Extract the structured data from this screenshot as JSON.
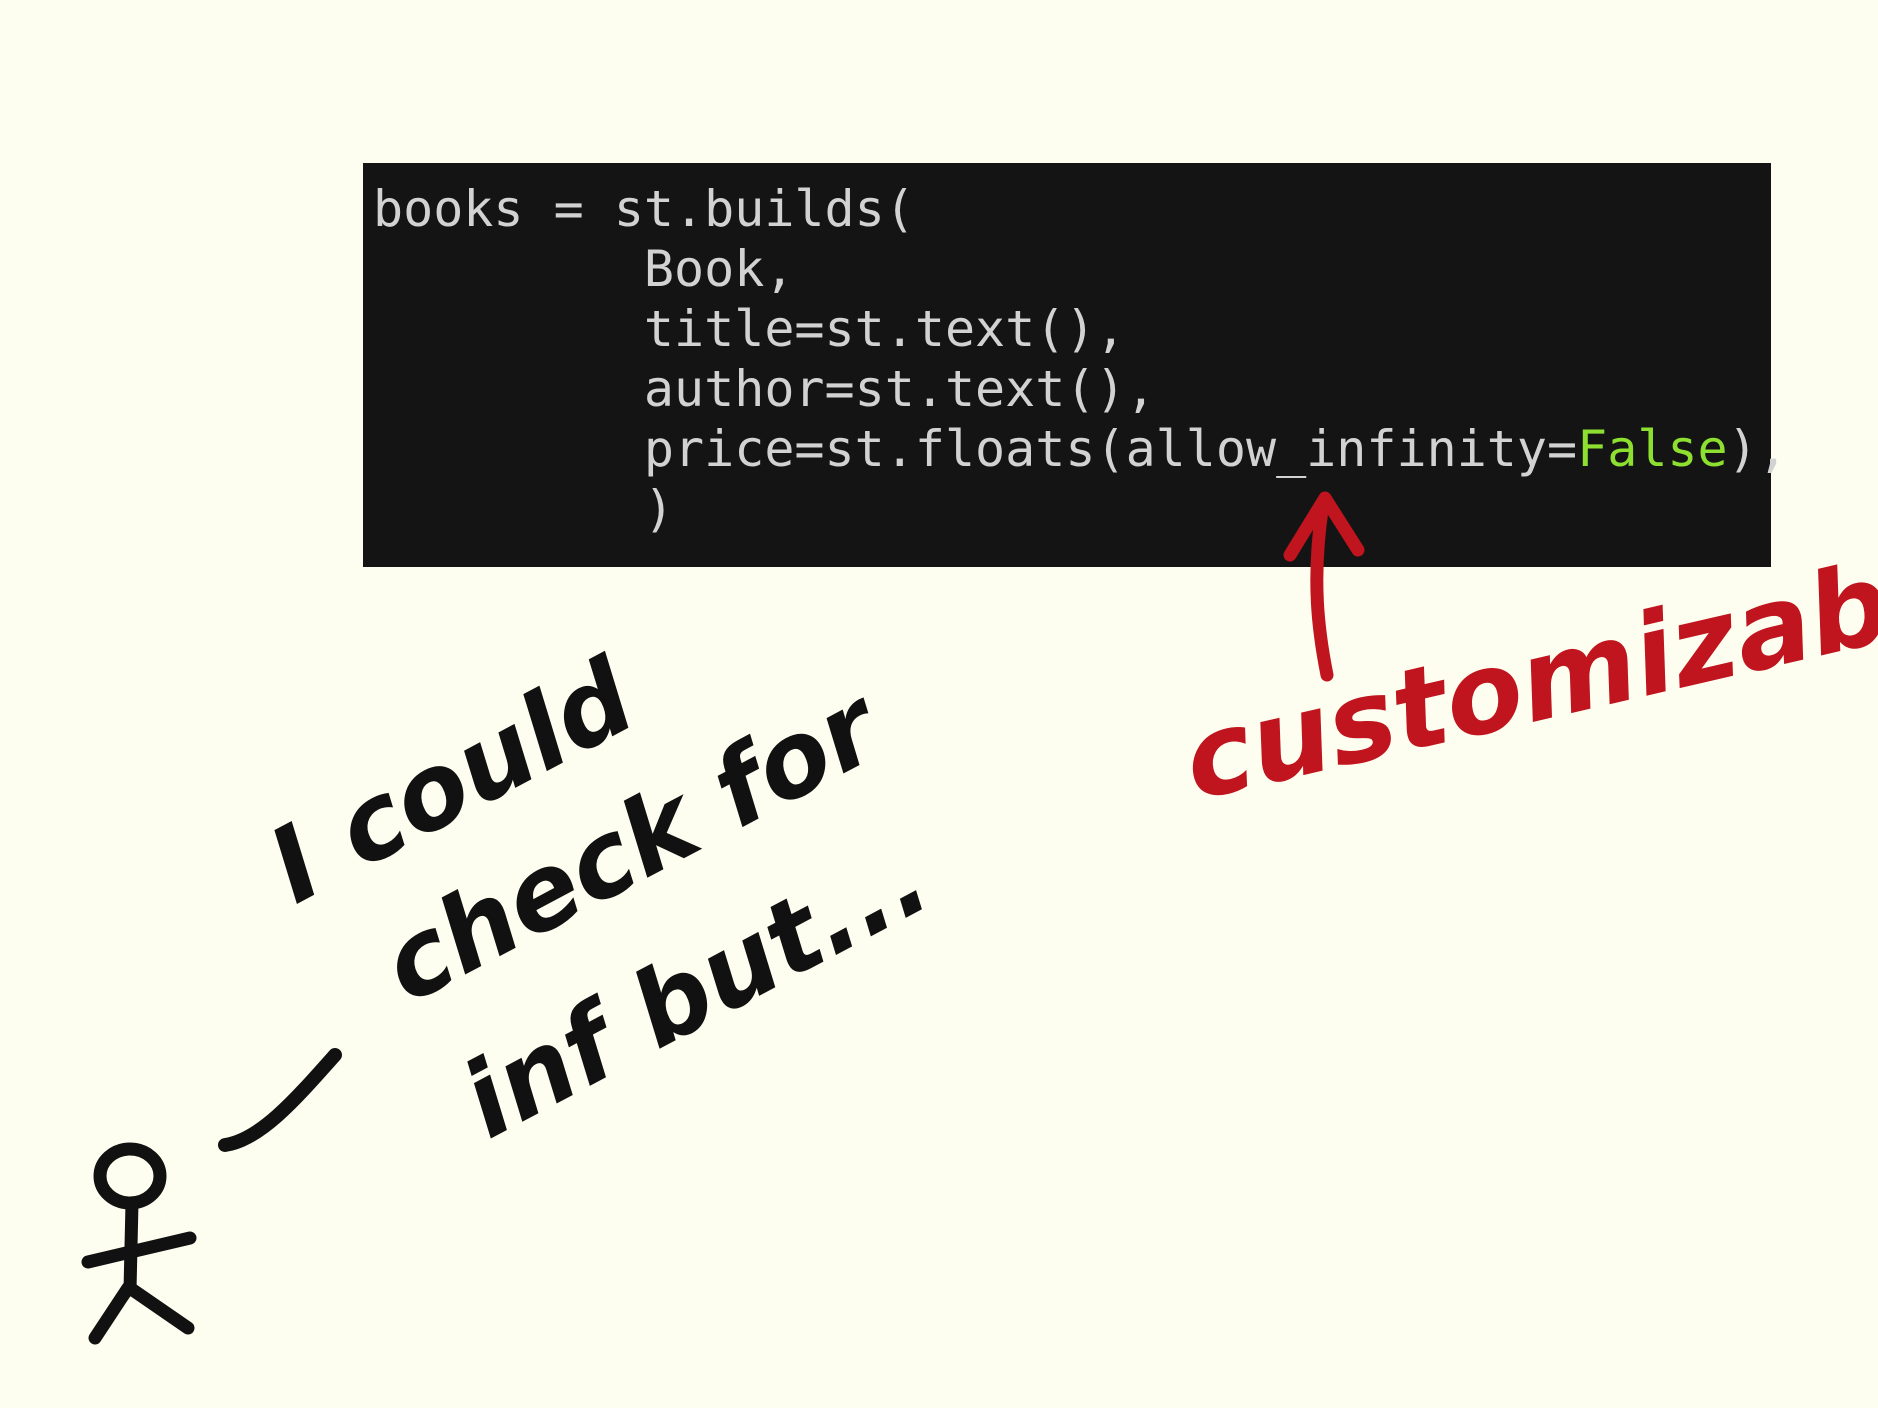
{
  "code": {
    "lines": [
      {
        "text": "books = st.builds("
      },
      {
        "text": "         Book,"
      },
      {
        "text": "         title=st.text(),"
      },
      {
        "text": "         author=st.text(),"
      },
      {
        "text": "         price=st.floats(allow_infinity=",
        "keyword": "False",
        "after": "),"
      },
      {
        "text": "         )"
      }
    ]
  },
  "annotations": {
    "customizable": "customizable",
    "musing": {
      "line1": "I could",
      "line2": "check for",
      "line3": "inf but..."
    }
  },
  "colors": {
    "background": "#fefef0",
    "code_background": "#141414",
    "code_text": "#d2d2d2",
    "keyword_false": "#8ee030",
    "annotation_red": "#c0141e",
    "ink_black": "#111111"
  },
  "icons": {
    "arrow": "up-arrow-icon",
    "figure": "stick-figure-icon",
    "speech_mark": "speech-line-icon"
  }
}
